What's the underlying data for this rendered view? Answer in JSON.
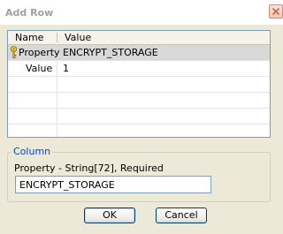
{
  "window": {
    "title": "Add Row",
    "close_icon": "close-x-icon"
  },
  "grid": {
    "columns": [
      "Name",
      "Value"
    ],
    "rows": [
      {
        "name": "Property",
        "value": "ENCRYPT_STORAGE",
        "icon": "key-icon",
        "selected": true
      },
      {
        "name": "Value",
        "value": "1",
        "selected": false
      }
    ]
  },
  "column_group": {
    "legend": "Column",
    "description": "Property - String[72], Required",
    "input_value": "ENCRYPT_STORAGE"
  },
  "buttons": {
    "ok": "OK",
    "cancel": "Cancel"
  }
}
